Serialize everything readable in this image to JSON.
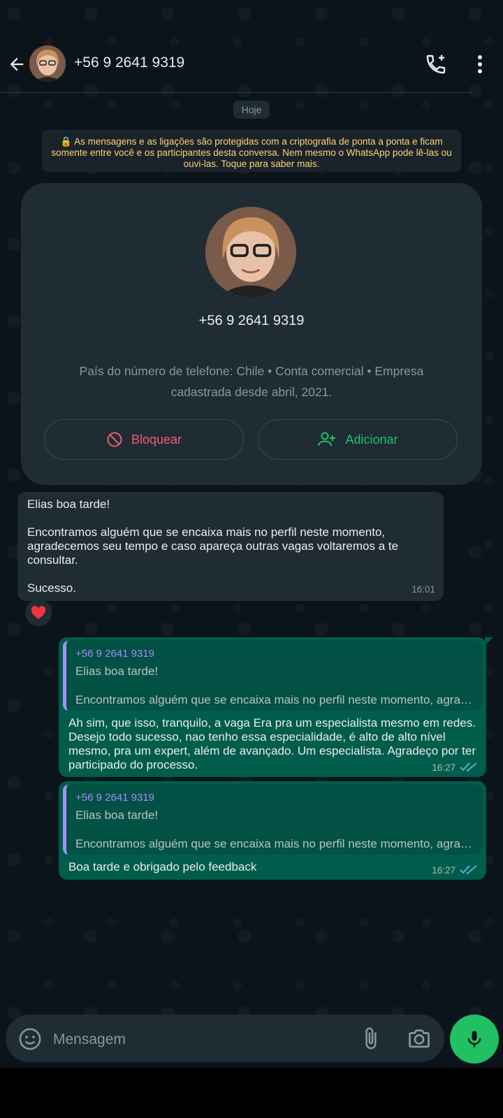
{
  "header": {
    "title": "+56 9 2641 9319"
  },
  "chat": {
    "date_chip": "Hoje",
    "encryption_notice": "🔒 As mensagens e as ligações são protegidas com a criptografia de ponta a ponta e ficam somente entre você e os participantes desta conversa. Nem mesmo o WhatsApp pode lê-las ou ouvi-las. Toque para saber mais."
  },
  "contact_card": {
    "number": "+56 9 2641 9319",
    "meta": "País do número de telefone: Chile • Conta comercial • Empresa cadastrada desde abril, 2021.",
    "block_label": "Bloquear",
    "add_label": "Adicionar"
  },
  "messages": {
    "incoming": {
      "line1": "Elias boa tarde!",
      "line2": "Encontramos alguém que se encaixa mais no perfil neste momento, agradecemos seu tempo e caso apareça outras vagas voltaremos a te consultar.",
      "line3": "Sucesso.",
      "time": "16:01",
      "reaction": "❤️"
    },
    "outgoing": [
      {
        "quote_author": "+56 9 2641 9319",
        "quote_line1": "Elias boa tarde!",
        "quote_line2": "Encontramos alguém que se encaixa mais no perfil neste momento, agradecemos seu tempo e caso apareça outras vagas voltaremos a te consultar.",
        "text": "Ah sim, que isso, tranquilo, a vaga Era pra um especialista mesmo em redes. Desejo todo sucesso, nao tenho essa especialidade, é alto de alto nível mesmo, pra um expert, além de avançado. Um especialista. Agradeço por ter participado do processo.",
        "time": "16:27"
      },
      {
        "quote_author": "+56 9 2641 9319",
        "quote_line1": "Elias boa tarde!",
        "quote_line2": "Encontramos alguém que se encaixa mais no perfil neste momento, agradecemos seu tempo e caso apareça outras vagas voltaremos a te consultar.",
        "text": "Boa tarde e obrigado pelo feedback",
        "time": "16:27"
      }
    ]
  },
  "composer": {
    "placeholder": "Mensagem"
  },
  "colors": {
    "accent_green": "#21c063",
    "outgoing_bubble": "#005c4b",
    "incoming_bubble": "#202c33",
    "block_red": "#f15c6d",
    "read_ticks": "#53bdeb",
    "quote_purple": "#a78bfa",
    "notice_yellow": "#ffd279"
  },
  "icons": [
    "back-arrow-icon",
    "add-call-icon",
    "more-vert-icon",
    "block-icon",
    "add-person-icon",
    "heart-icon",
    "double-check-icon",
    "emoji-icon",
    "attach-icon",
    "camera-icon",
    "mic-icon"
  ]
}
